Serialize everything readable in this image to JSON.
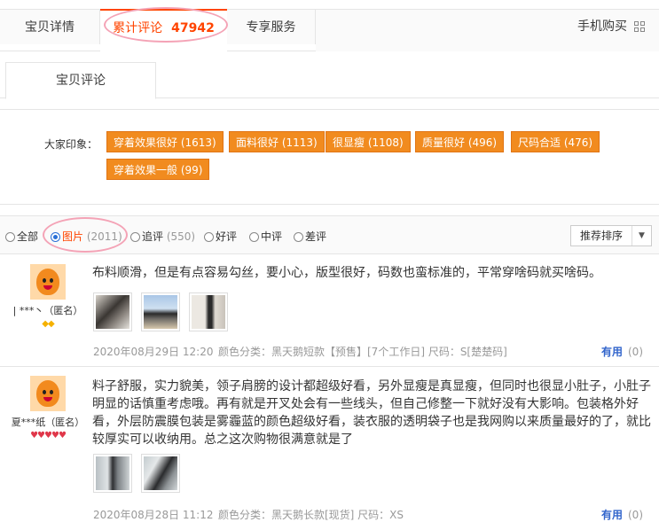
{
  "tabs": {
    "details": "宝贝详情",
    "reviews_label": "累计评论",
    "reviews_count": "47942",
    "service": "专享服务",
    "mobile": "手机购买"
  },
  "subtab": "宝贝评论",
  "impressions": {
    "label": "大家印象：",
    "tags": [
      "穿着效果很好 (1613)",
      "面料很好 (1113)",
      "很显瘦 (1108)",
      "质量很好 (496)",
      "尺码合适 (476)",
      "穿着效果一般 (99)"
    ]
  },
  "filters": {
    "all": "全部",
    "pics_label": "图片",
    "pics_count": "(2011)",
    "followup_label": "追评",
    "followup_count": "(550)",
    "good": "好评",
    "mid": "中评",
    "bad": "差评",
    "sort": "推荐排序"
  },
  "reviews": [
    {
      "user": "| ***丶（匿名）",
      "badges": "◆◆",
      "text": "布料顺滑，但是有点容易勾丝，要小心，版型很好，码数也蛮标准的，平常穿啥码就买啥码。",
      "date": "2020年08月29日 12:20",
      "spec": "颜色分类：黑天鹅短款【预售】[7个工作日]  尺码：S[楚楚码]",
      "useful_label": "有用",
      "useful_count": "(0)"
    },
    {
      "user": "夏***纸（匿名）",
      "badges": "♥♥♥♥♥",
      "text": "料子舒服，实力貌美，领子肩膀的设计都超级好看，另外显瘦是真显瘦，但同时也很显小肚子，小肚子明显的话慎重考虑哦。再有就是开叉处会有一些线头，但自己修整一下就好没有大影响。包装格外好看，外层防震膜包装是雾霾蓝的颜色超级好看，装衣服的透明袋子也是我网购以来质量最好的了，就比较厚实可以收纳用。总之这次购物很满意就是了",
      "date": "2020年08月28日 11:12",
      "spec": "颜色分类：黑天鹅长款[现货]  尺码：XS",
      "useful_label": "有用",
      "useful_count": "(0)"
    }
  ],
  "colors": {
    "accent": "#ff4400",
    "tag_bg": "#f18b1f",
    "link": "#3366cc",
    "highlight_circle": "#f4a3b6"
  }
}
